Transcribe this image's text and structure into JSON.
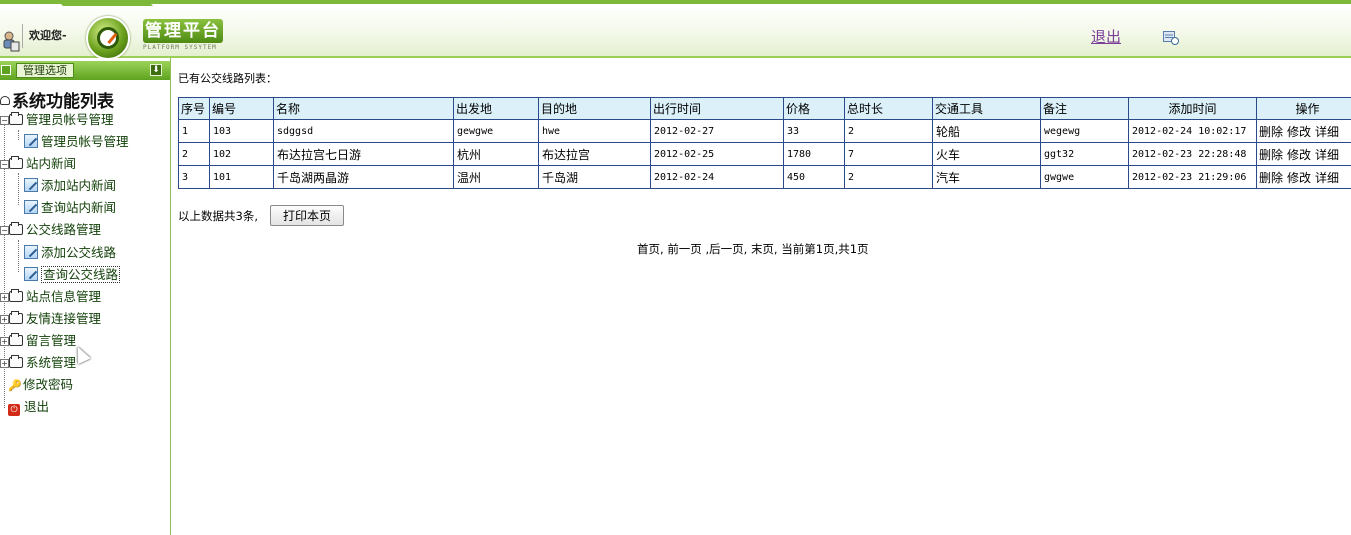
{
  "header": {
    "welcome": "欢迎您-",
    "brand": "管理平台",
    "brand_sub": "PLATFORM SYSYTEM",
    "logout": "退出"
  },
  "sidebar": {
    "tab_label": "管理选项",
    "tree_title": "系统功能列表",
    "nodes": [
      {
        "label": "管理员帐号管理"
      },
      {
        "label": "管理员帐号管理"
      },
      {
        "label": "站内新闻"
      },
      {
        "label": "添加站内新闻"
      },
      {
        "label": "查询站内新闻"
      },
      {
        "label": "公交线路管理"
      },
      {
        "label": "添加公交线路"
      },
      {
        "label": "查询公交线路"
      },
      {
        "label": "站点信息管理"
      },
      {
        "label": "友情连接管理"
      },
      {
        "label": "留言管理"
      },
      {
        "label": "系统管理"
      },
      {
        "label": "修改密码"
      },
      {
        "label": "退出"
      }
    ]
  },
  "main": {
    "list_title": "已有公交线路列表：",
    "columns": [
      "序号",
      "编号",
      "名称",
      "出发地",
      "目的地",
      "出行时间",
      "价格",
      "总时长",
      "交通工具",
      "备注",
      "添加时间",
      "操作"
    ],
    "rows": [
      [
        "1",
        "103",
        "sdggsd",
        "gewgwe",
        "hwe",
        "2012-02-27",
        "33",
        "2",
        "轮船",
        "wegewg",
        "2012-02-24 10:02:17"
      ],
      [
        "2",
        "102",
        "布达拉宫七日游",
        "杭州",
        "布达拉宫",
        "2012-02-25",
        "1780",
        "7",
        "火车",
        "ggt32",
        "2012-02-23 22:28:48"
      ],
      [
        "3",
        "101",
        "千岛湖两晶游",
        "温州",
        "千岛湖",
        "2012-02-24",
        "450",
        "2",
        "汽车",
        "gwgwe",
        "2012-02-23 21:29:06"
      ]
    ],
    "ops": {
      "delete": "删除",
      "edit": "修改",
      "detail": "详细"
    },
    "summary": "以上数据共3条,",
    "print_button": "打印本页",
    "pager": {
      "first": "首页,",
      "prev": "前一页",
      "next": ",后一页,",
      "last": "末页,",
      "current": "当前第1页,",
      "total": "共1页"
    }
  }
}
